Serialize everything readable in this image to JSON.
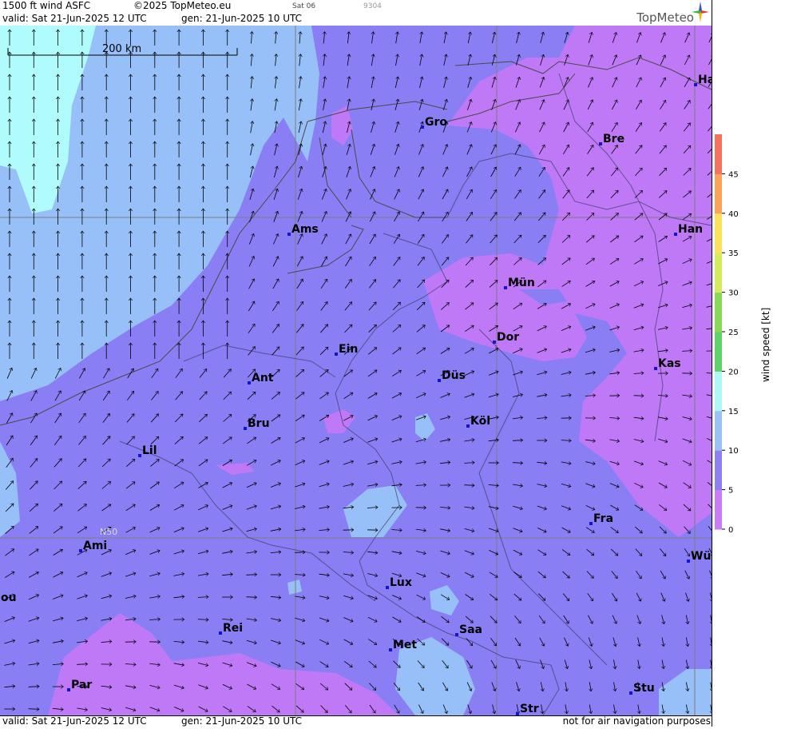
{
  "header": {
    "product": "1500 ft wind ASFC",
    "copyright": "©2025 TopMeteo.eu",
    "day_code": "Sat 06",
    "id_code": "9304",
    "valid": "valid:  Sat  21-Jun-2025  12 UTC",
    "gen": "gen: 21-Jun-2025 10 UTC",
    "brand": "TopMeteo"
  },
  "map": {
    "scale_label": "200 km",
    "lat_label": "N50",
    "cities": [
      {
        "name": "Gro"
      },
      {
        "name": "Bre"
      },
      {
        "name": "Ha"
      },
      {
        "name": "Ams"
      },
      {
        "name": "Han"
      },
      {
        "name": "Mün"
      },
      {
        "name": "Dor"
      },
      {
        "name": "Ein"
      },
      {
        "name": "Kas"
      },
      {
        "name": "Ant"
      },
      {
        "name": "Düs"
      },
      {
        "name": "Köl"
      },
      {
        "name": "Bru"
      },
      {
        "name": "Lil"
      },
      {
        "name": "Fra"
      },
      {
        "name": "Ami"
      },
      {
        "name": "Wü"
      },
      {
        "name": "Lux"
      },
      {
        "name": "ou"
      },
      {
        "name": "Rei"
      },
      {
        "name": "Saa"
      },
      {
        "name": "Met"
      },
      {
        "name": "Par"
      },
      {
        "name": "Stu"
      },
      {
        "name": "Str"
      }
    ],
    "colors": {
      "calm": "#bf79f6",
      "light": "#8a7ef4",
      "moderate": "#96c0f7",
      "fresh": "#b0fbfb"
    }
  },
  "colorbar": {
    "title": "wind  speed  [kt]",
    "ticks": [
      "0",
      "5",
      "10",
      "15",
      "20",
      "25",
      "30",
      "35",
      "40",
      "45"
    ],
    "colors": [
      "#c97cf5",
      "#8e7ff2",
      "#9ac2f4",
      "#aef7f5",
      "#5fd36a",
      "#8ad85a",
      "#d6ea5e",
      "#fbe15c",
      "#f9a45a",
      "#f5735e"
    ]
  },
  "footer": {
    "valid": "valid:  Sat  21-Jun-2025  12 UTC",
    "gen": "gen: 21-Jun-2025 10 UTC",
    "disclaimer": "not for air navigation purposes"
  }
}
